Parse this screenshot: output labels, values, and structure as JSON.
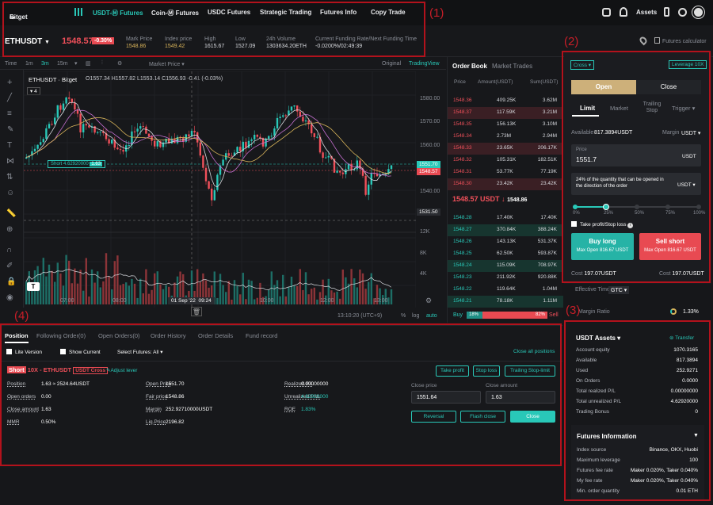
{
  "nav": {
    "logo": "Bitget",
    "items": [
      "USDT-Ⓜ Futures",
      "Coin-Ⓜ Futures",
      "USDC Futures",
      "Strategic Trading",
      "Futures Info",
      "Copy Trade"
    ],
    "assets": "Assets"
  },
  "ticker": {
    "symbol": "ETHUSDT",
    "price": "1548.57",
    "change": "-0.30%",
    "mark_label": "Mark Price",
    "mark": "1548.86",
    "index_label": "Index price",
    "index": "1549.42",
    "high_label": "High",
    "high": "1615.67",
    "low_label": "Low",
    "low": "1527.09",
    "vol_label": "24h Volume",
    "vol": "1303634.20ETH",
    "fund_label": "Current Funding Rate/Next Funding Time",
    "fund": "-0.0200%/02:49:39",
    "calc": "Futures calculator"
  },
  "chart": {
    "toolbar": [
      "Time",
      "1m",
      "3m",
      "15m",
      "Market Price"
    ],
    "original": "Original",
    "tv": "TradingView",
    "title": "ETHUSDT · Bitget",
    "ohlc": "O1557.34 H1557.82 L1553.14 C1556.93 -0.41 (-0.03%)",
    "short_label": "Short 4.62920000",
    "short_qty": "1.63",
    "price_axis": [
      "1580.00",
      "1570.00",
      "1560.00",
      "1551.70",
      "1548.57",
      "1540.00",
      "1531.50"
    ],
    "vol_axis": [
      "12K",
      "8K",
      "4K"
    ],
    "time_axis": [
      "07:00",
      "08:00",
      "10:00",
      "12:00",
      "13:00"
    ],
    "crosshair_time": "01 Sep '22",
    "crosshair_clock": "09:24",
    "clock": "13:10:20 (UTC+9)",
    "scale": [
      "%",
      "log",
      "auto"
    ],
    "zoom": "4"
  },
  "orderbook": {
    "tab1": "Order Book",
    "tab2": "Market Trades",
    "h_price": "Price",
    "h_amount": "Amount(USDT)",
    "h_sum": "Sum(USDT)",
    "asks": [
      [
        "1548.36",
        "409.25K",
        "3.62M"
      ],
      [
        "1548.37",
        "117.59K",
        "3.21M"
      ],
      [
        "1548.35",
        "156.13K",
        "3.10M"
      ],
      [
        "1548.34",
        "2.73M",
        "2.94M"
      ],
      [
        "1548.33",
        "23.65K",
        "206.17K"
      ],
      [
        "1548.32",
        "105.31K",
        "182.51K"
      ],
      [
        "1548.31",
        "53.77K",
        "77.19K"
      ],
      [
        "1548.30",
        "23.42K",
        "23.42K"
      ]
    ],
    "mid": "1548.57 USDT ↓",
    "mid_mark": "1548.86",
    "bids": [
      [
        "1548.28",
        "17.40K",
        "17.40K"
      ],
      [
        "1548.27",
        "370.84K",
        "388.24K"
      ],
      [
        "1548.26",
        "143.13K",
        "531.37K"
      ],
      [
        "1548.25",
        "62.50K",
        "593.87K"
      ],
      [
        "1548.24",
        "115.09K",
        "708.97K"
      ],
      [
        "1548.23",
        "211.92K",
        "920.88K"
      ],
      [
        "1548.22",
        "119.64K",
        "1.04M"
      ],
      [
        "1548.21",
        "78.18K",
        "1.11M"
      ]
    ],
    "buy": "Buy",
    "buy_pct": "18%",
    "sell_pct": "82%",
    "sell": "Sell"
  },
  "trade": {
    "cross": "Cross",
    "leverage": "Leverage 10X",
    "open": "Open",
    "close": "Close",
    "tabs": [
      "Limit",
      "Market",
      "Trailing Stop",
      "Trigger"
    ],
    "avail_label": "Available",
    "avail": "817.3894USDT",
    "margin": "Margin",
    "margin_cur": "USDT",
    "price_label": "Price",
    "price": "1551.7",
    "price_unit": "USDT",
    "qty_hint": "24% of the quantity that can be opened in the direction of the order",
    "qty_unit": "USDT",
    "slider": [
      "0%",
      "25%",
      "50%",
      "75%",
      "100%"
    ],
    "slider_fraction": 0.25,
    "tpsl": "Take profit/Stop loss",
    "long": "Buy long",
    "long_max": "Max Open 816.67 USDT",
    "short": "Sell short",
    "short_max": "Max Open 816.67 USDT",
    "cost_label": "Cost",
    "cost_long": "197.07USDT",
    "cost_short": "197.07USDT",
    "eff_label": "Effective Time",
    "eff": "GTC",
    "margin_ratio": "Margin Ratio",
    "margin_ratio_val": "1.33%"
  },
  "position": {
    "tabs": [
      "Position",
      "Following Order(0)",
      "Open Orders(0)",
      "Order History",
      "Order Details",
      "Fund record"
    ],
    "lite": "Lite Version",
    "show_current": "Show Current",
    "select": "Select Futures:",
    "select_val": "All",
    "close_all": "Close all positions",
    "side": "Short",
    "title": "10X - ETHUSDT",
    "mode": "USDT Cross",
    "adjust": "Adjust lever",
    "take_profit": "Take profit",
    "stop_loss": "Stop loss",
    "trailing": "Trailing Stop-limit",
    "col1": [
      [
        "Position",
        "1.63 ≈ 2524.64USDT"
      ],
      [
        "Open orders",
        "0.00"
      ],
      [
        "Close amount",
        "1.63"
      ],
      [
        "MMR",
        "0.50%"
      ]
    ],
    "col2": [
      [
        "Open Price",
        "1551.70"
      ],
      [
        "Fair price",
        "1548.86"
      ],
      [
        "Margin",
        "252.92710000USDT"
      ],
      [
        "Liq.Price",
        "2196.82"
      ]
    ],
    "col3": [
      [
        "Realized P/L",
        "0.00000000"
      ],
      [
        "Unrealized PNL",
        "4.62920000"
      ],
      [
        "ROE",
        "1.83%"
      ]
    ],
    "close_price_label": "Close price",
    "close_price": "1551.64",
    "close_amount_label": "Close amount",
    "close_amount": "1.63",
    "reversal": "Reversal",
    "flash": "Flash close",
    "close": "Close"
  },
  "assets": {
    "title": "USDT Assets",
    "transfer": "Transfer",
    "rows": [
      [
        "Account equity",
        "1070.3165"
      ],
      [
        "Available",
        "817.3894"
      ],
      [
        "Used",
        "252.9271"
      ],
      [
        "On Orders",
        "0.0000"
      ],
      [
        "Total realized P/L",
        "0.00000000"
      ],
      [
        "Total unrealized P/L",
        "4.62920000"
      ],
      [
        "Trading Bonus",
        "0"
      ]
    ],
    "fi_title": "Futures Information",
    "fi_rows": [
      [
        "Index source",
        "Binance, OKX, Huobi"
      ],
      [
        "Maximum leverage",
        "100"
      ],
      [
        "Futures fee rate",
        "Maker 0.020%, Taker 0.040%"
      ],
      [
        "My fee rate",
        "Maker 0.020%, Taker 0.040%"
      ],
      [
        "Min. order quantity",
        "0.01 ETH"
      ]
    ]
  },
  "annotations": [
    "(1)",
    "(2)",
    "(3)",
    "(4)"
  ]
}
